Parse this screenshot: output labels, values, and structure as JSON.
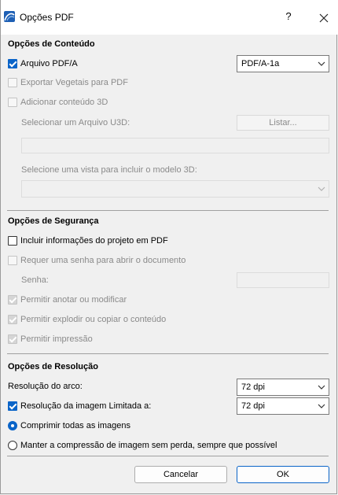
{
  "window": {
    "title": "Opções PDF",
    "help_label": "?"
  },
  "content": {
    "title": "Opções de Conteúdo",
    "pdfa_label": "Arquivo PDF/A",
    "pdfa_value": "PDF/A-1a",
    "vegetals_label": "Exportar Vegetais para PDF",
    "add3d_label": "Adicionar conteúdo 3D",
    "u3d_label": "Selecionar um Arquivo U3D:",
    "list_button": "Listar...",
    "u3d_path": "",
    "view_label": "Selecione uma vista para incluir o modelo 3D:",
    "view_value": ""
  },
  "security": {
    "title": "Opções de Segurança",
    "project_info_label": "Incluir informações do projeto em PDF",
    "require_pw_label": "Requer uma senha para abrir o documento",
    "password_label": "Senha:",
    "password_value": "",
    "annotate_label": "Permitir anotar ou modificar",
    "explode_label": "Permitir explodir ou copiar o conteúdo",
    "print_label": "Permitir impressão"
  },
  "resolution": {
    "title": "Opções de Resolução",
    "arc_label": "Resolução do arco:",
    "arc_value": "72 dpi",
    "image_label": "Resolução da imagem Limitada a:",
    "image_value": "72 dpi",
    "compress_all_label": "Comprimir todas as imagens",
    "lossless_label": "Manter a compressão de imagem sem perda, sempre que possível"
  },
  "footer": {
    "cancel": "Cancelar",
    "ok": "OK"
  },
  "colors": {
    "accent": "#0a64c8",
    "disabled_text": "#8a8a8a"
  }
}
